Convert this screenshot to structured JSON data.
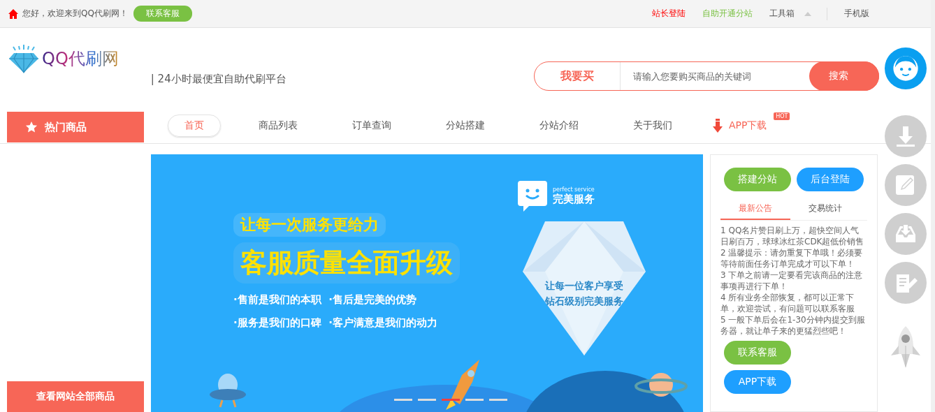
{
  "top_bar": {
    "welcome": "您好，欢迎来到QQ代刷网！",
    "contact_button": "联系客服",
    "links": [
      {
        "label": "站长登陆",
        "color": "#ff0000",
        "kind": "link"
      },
      {
        "label": "自助开通分站",
        "color": "#7ac143",
        "kind": "link"
      },
      {
        "label": "工具箱",
        "color": "#555555",
        "kind": "dropdown"
      },
      {
        "label": "手机版",
        "color": "#555555",
        "kind": "link"
      }
    ]
  },
  "header": {
    "logo_text": "QQ代刷网",
    "slogan": "| 24小时最便宜自助代刷平台",
    "search": {
      "label": "我要买",
      "placeholder": "请输入您要购买商品的关键词",
      "button": "搜索"
    }
  },
  "nav": {
    "sidebar_title": "热门商品",
    "items": [
      {
        "label": "首页",
        "selected": true,
        "kind": "link"
      },
      {
        "label": "商品列表",
        "selected": false,
        "kind": "link"
      },
      {
        "label": "订单查询",
        "selected": false,
        "kind": "link"
      },
      {
        "label": "分站搭建",
        "selected": false,
        "kind": "link"
      },
      {
        "label": "分站介绍",
        "selected": false,
        "kind": "link"
      },
      {
        "label": "关于我们",
        "selected": false,
        "kind": "link"
      },
      {
        "label": "APP下载",
        "selected": false,
        "kind": "app",
        "badge": "HOT"
      }
    ]
  },
  "sidebar": {
    "all_button": "查看网站全部商品"
  },
  "banner": {
    "tagline": "让每一次服务更给力",
    "headline": "客服质量全面升级",
    "bullets": [
      "·售前是我们的本职  ·售后是完美的优势",
      "·服务是我们的口碑  ·客户满意是我们的动力"
    ],
    "service_en": "perfect service",
    "service_cn": "完美服务",
    "diamond_lines": [
      "让每一位客户享受",
      "钻石级别完美服务"
    ],
    "indicators": [
      {
        "selected": false
      },
      {
        "selected": false
      },
      {
        "selected": true
      },
      {
        "selected": false
      },
      {
        "selected": false
      }
    ]
  },
  "right_panel": {
    "buttons": [
      {
        "label": "搭建分站",
        "color": "#7ac143"
      },
      {
        "label": "后台登陆",
        "color": "#1e9fff"
      }
    ],
    "tabs": [
      {
        "label": "最新公告",
        "selected": true
      },
      {
        "label": "交易统计",
        "selected": false
      }
    ],
    "notices": [
      "1 QQ名片赞日刷上万，超快空间人气日刷百万，球球冰红茶CDK超低价销售",
      "2 温馨提示：请勿重复下单哦！必须要等待前面任务订单完成才可以下单！",
      "3 下单之前请一定要看完该商品的注意事项再进行下单！",
      "4 所有业务全部恢复，都可以正常下单，欢迎尝试，有问题可以联系客服",
      "5 一般下单后会在1-30分钟内提交到服务器，就让单子来的更猛烈些吧！"
    ],
    "contact_button": "联系客服",
    "app_button": "APP下载"
  }
}
